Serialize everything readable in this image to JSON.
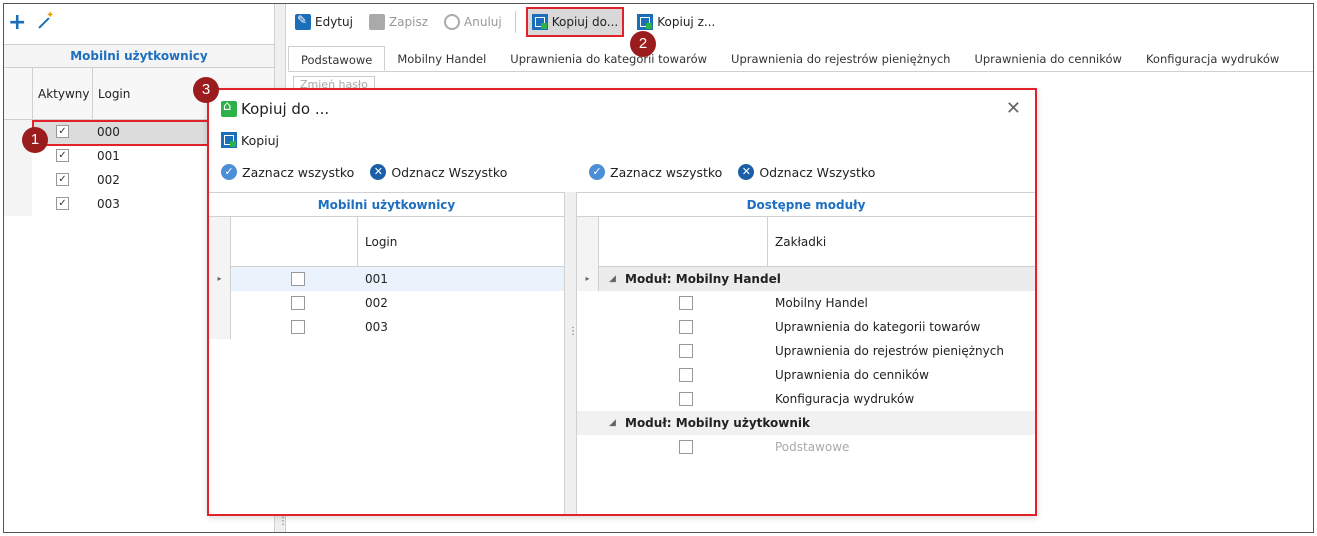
{
  "left": {
    "title": "Mobilni użytkownicy",
    "columns": [
      "Aktywny",
      "Login"
    ],
    "rows": [
      {
        "active": true,
        "login": "000"
      },
      {
        "active": true,
        "login": "001"
      },
      {
        "active": true,
        "login": "002"
      },
      {
        "active": true,
        "login": "003"
      }
    ]
  },
  "toolbar": {
    "edit": "Edytuj",
    "save": "Zapisz",
    "cancel": "Anuluj",
    "copy_to": "Kopiuj do...",
    "copy_from": "Kopiuj z..."
  },
  "tabs": [
    "Podstawowe",
    "Mobilny Handel",
    "Uprawnienia do kategorii towarów",
    "Uprawnienia do rejestrów pieniężnych",
    "Uprawnienia do cenników",
    "Konfiguracja wydruków"
  ],
  "ghost_button": "Zmień hasło",
  "dialog": {
    "title": "Kopiuj do ...",
    "copy": "Kopiuj",
    "select_all": "Zaznacz wszystko",
    "deselect_all": "Odznacz Wszystko",
    "left_title": "Mobilni użytkownicy",
    "left_col": "Login",
    "left_rows": [
      "001",
      "002",
      "003"
    ],
    "right_title": "Dostępne moduły",
    "right_col": "Zakładki",
    "group1": "Moduł: Mobilny Handel",
    "group1_items": [
      "Mobilny Handel",
      "Uprawnienia do kategorii towarów",
      "Uprawnienia do rejestrów pieniężnych",
      "Uprawnienia do cenników",
      "Konfiguracja wydruków"
    ],
    "group2": "Moduł: Mobilny użytkownik",
    "group2_items": [
      "Podstawowe"
    ]
  },
  "badges": [
    "1",
    "2",
    "3"
  ],
  "colors": {
    "accent": "#1e6fbf",
    "highlight": "#e0222a",
    "badge": "#9b1c1c"
  }
}
